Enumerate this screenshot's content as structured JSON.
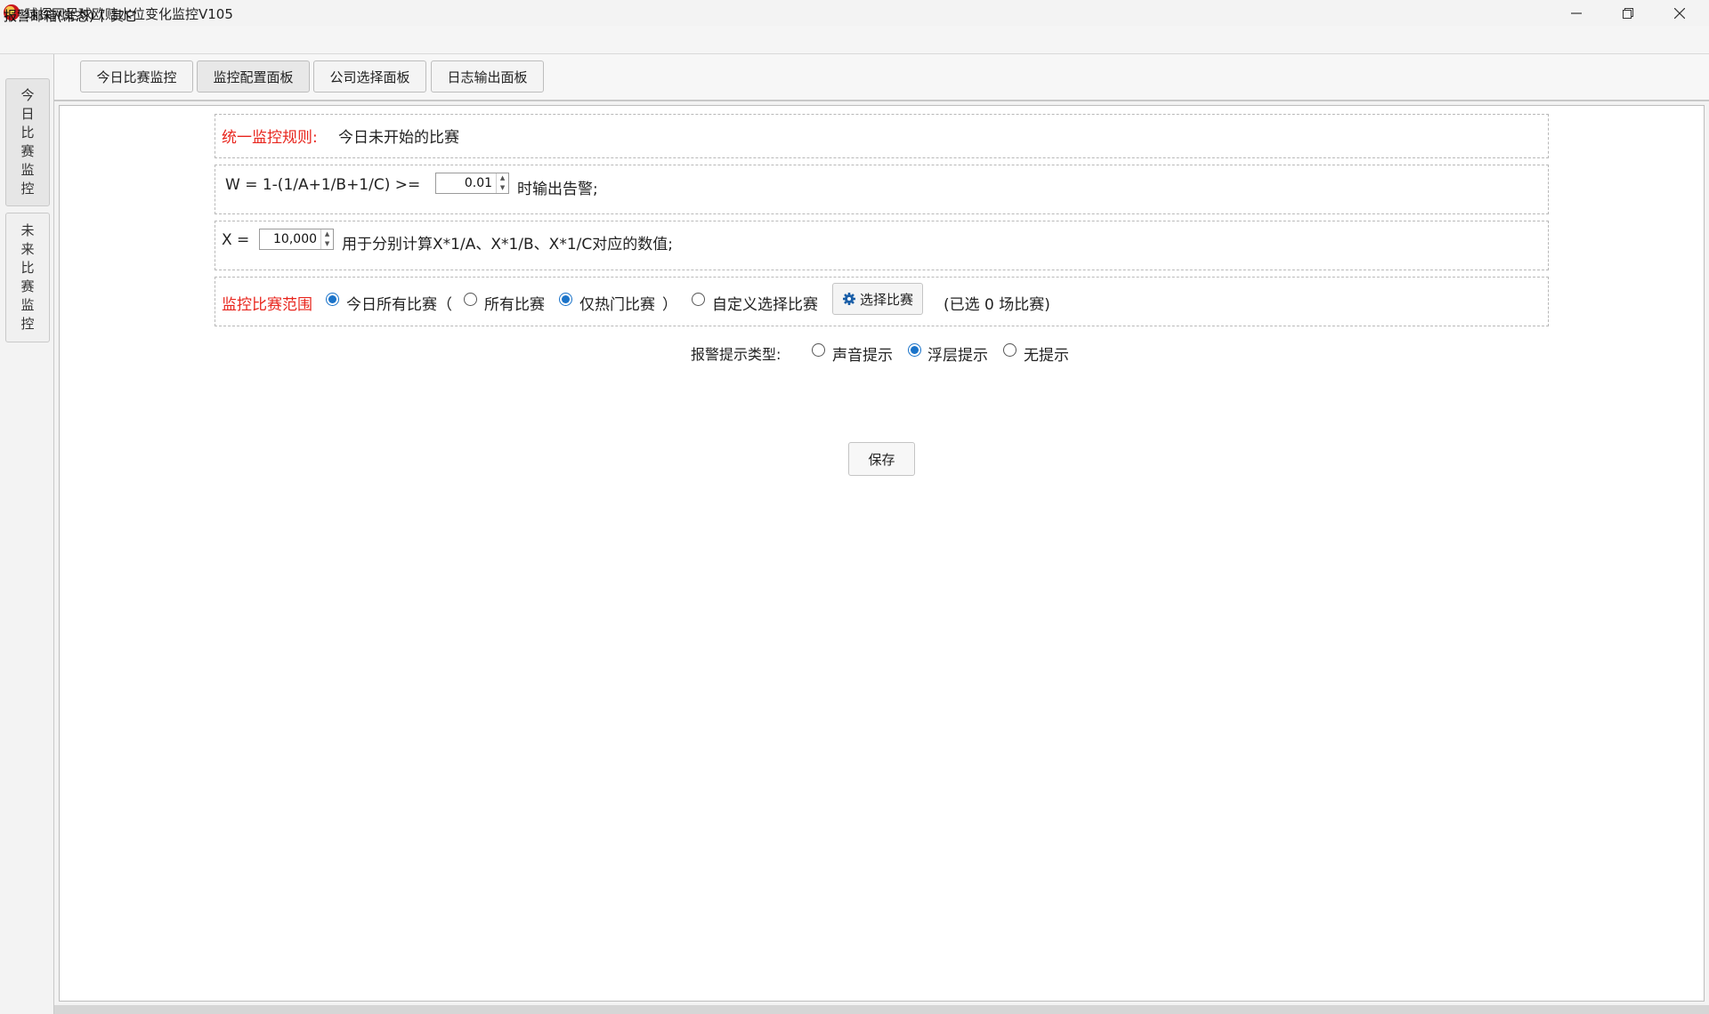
{
  "window": {
    "title": "球探网足球欧赔水位变化监控V105",
    "minimize_icon": "minimize-icon",
    "maximize_icon": "restore-icon",
    "close_icon": "close-icon"
  },
  "menubar": {
    "items": [
      {
        "label": "报警邮箱(常态)"
      },
      {
        "label": "|"
      },
      {
        "label": "其它"
      }
    ]
  },
  "sidebar": {
    "tabs": [
      {
        "chars": [
          "今",
          "日",
          "比",
          "赛",
          "监",
          "控"
        ],
        "selected": true
      },
      {
        "chars": [
          "未",
          "来",
          "比",
          "赛",
          "监",
          "控"
        ],
        "selected": false
      }
    ]
  },
  "tabs": [
    {
      "label": "今日比赛监控"
    },
    {
      "label": "监控配置面板",
      "selected": true
    },
    {
      "label": "公司选择面板"
    },
    {
      "label": "日志输出面板"
    }
  ],
  "config": {
    "rule_label": "统一监控规则:",
    "rule_text": "今日未开始的比赛",
    "w_formula": "W = 1-(1/A+1/B+1/C) >=",
    "w_value": "0.01",
    "w_suffix": "时输出告警;",
    "x_label": "X =",
    "x_value": "10,000",
    "x_suffix": "用于分别计算X*1/A、X*1/B、X*1/C对应的数值;",
    "scope_label": "监控比赛范围",
    "scope_today": "今日所有比赛（",
    "scope_all": "所有比赛",
    "scope_hot": "仅热门比赛",
    "scope_close_paren": "）",
    "scope_custom": "自定义选择比赛",
    "select_button": "选择比赛",
    "selected_count_text": "(已选  0  场比赛)",
    "alert_type_label": "报警提示类型:",
    "alert_sound": "声音提示",
    "alert_overlay": "浮层提示",
    "alert_none": "无提示",
    "save_button": "保存"
  },
  "state": {
    "scope_today_checked": true,
    "scope_all_checked": false,
    "scope_hot_checked": true,
    "scope_custom_checked": false,
    "alert_type": "浮层提示"
  },
  "colors": {
    "accent_red": "#e8261e",
    "radio_blue": "#1a73c9"
  }
}
